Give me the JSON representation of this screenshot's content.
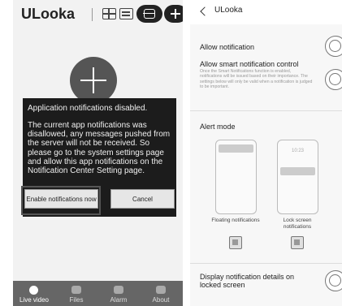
{
  "left": {
    "app_title": "ULooka",
    "dialog": {
      "title": "Application notifications disabled.",
      "body": "The current app notifications was disallowed, any messages pushed from the server will not be received. So please go to the system settings page and allow this app notifications on the Notification Center Setting page.",
      "enable_label": "Enable notifications now",
      "cancel_label": "Cancel"
    },
    "nav": [
      {
        "label": "Live video",
        "icon": "play-icon"
      },
      {
        "label": "Files",
        "icon": "folder-icon"
      },
      {
        "label": "Alarm",
        "icon": "message-icon"
      },
      {
        "label": "About",
        "icon": "puzzle-icon"
      }
    ]
  },
  "right": {
    "title": "ULooka",
    "allow_notification": "Allow notification",
    "smart_notification": "Allow smart notification control",
    "smart_desc": "Once the Smart Notifications function is enabled, notifications will be issued based on their importance. The settings below will only be valid when a notification is judged to be important.",
    "alert_mode": "Alert mode",
    "lockscreen_time": "10:23",
    "floating_label": "Floating notifications",
    "lockscreen_label": "Lock screen notifications",
    "display_details": "Display notification details on locked screen"
  }
}
